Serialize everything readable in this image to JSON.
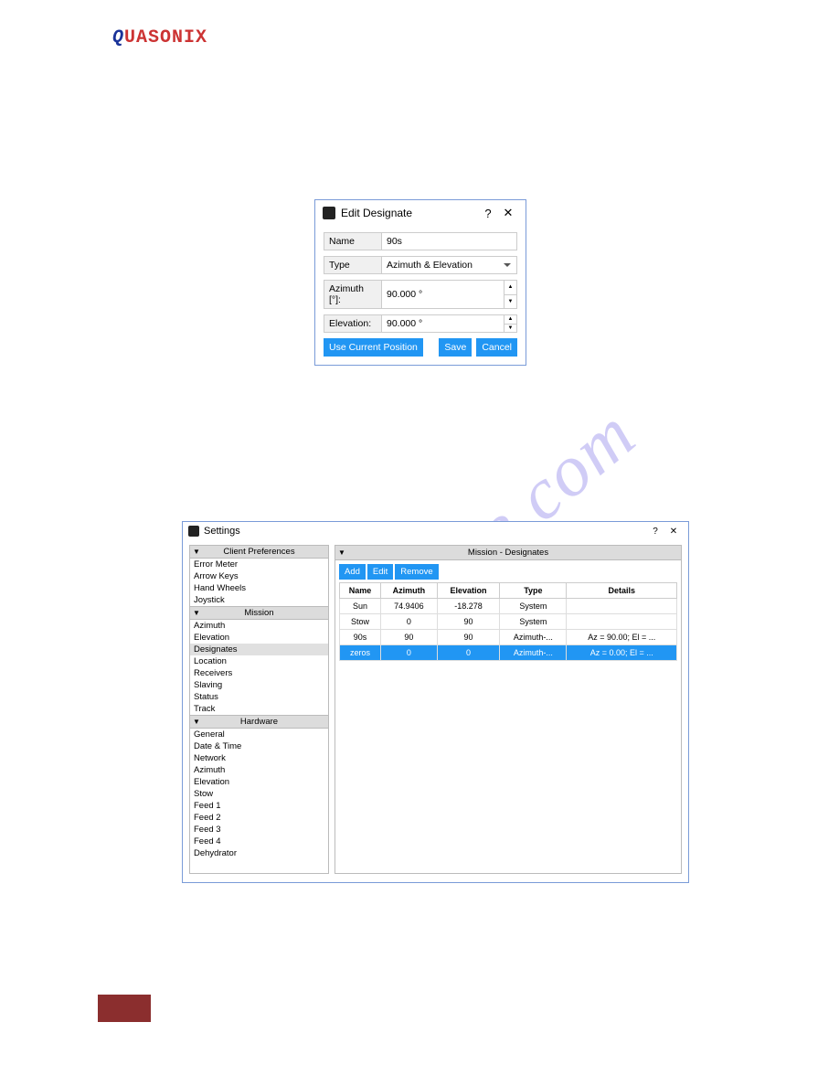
{
  "logo": {
    "q": "Q",
    "rest": "UASONIX"
  },
  "watermark": "manualshive.com",
  "editDialog": {
    "title": "Edit Designate",
    "help": "?",
    "close": "✕",
    "fields": {
      "nameLabel": "Name",
      "nameValue": "90s",
      "typeLabel": "Type",
      "typeValue": "Azimuth & Elevation",
      "azimuthLabel": "Azimuth [°]:",
      "azimuthValue": "90.000 °",
      "elevationLabel": "Elevation:",
      "elevationValue": "90.000 °"
    },
    "buttons": {
      "useCurrent": "Use Current Position",
      "save": "Save",
      "cancel": "Cancel"
    }
  },
  "settings": {
    "title": "Settings",
    "help": "?",
    "close": "✕",
    "sidebar": {
      "sections": [
        {
          "head": "Client Preferences",
          "items": [
            "Error Meter",
            "Arrow Keys",
            "Hand Wheels",
            "Joystick"
          ]
        },
        {
          "head": "Mission",
          "items": [
            "Azimuth",
            "Elevation",
            "Designates",
            "Location",
            "Receivers",
            "Slaving",
            "Status",
            "Track"
          ],
          "selected": "Designates"
        },
        {
          "head": "Hardware",
          "items": [
            "General",
            "Date & Time",
            "Network",
            "Azimuth",
            "Elevation",
            "Stow",
            "Feed 1",
            "Feed 2",
            "Feed 3",
            "Feed 4",
            "Dehydrator"
          ]
        }
      ]
    },
    "main": {
      "head": "Mission - Designates",
      "toolbar": {
        "add": "Add",
        "edit": "Edit",
        "remove": "Remove"
      },
      "columns": [
        "Name",
        "Azimuth",
        "Elevation",
        "Type",
        "Details"
      ],
      "rows": [
        {
          "name": "Sun",
          "azimuth": "74.9406",
          "elevation": "-18.278",
          "type": "System",
          "details": ""
        },
        {
          "name": "Stow",
          "azimuth": "0",
          "elevation": "90",
          "type": "System",
          "details": ""
        },
        {
          "name": "90s",
          "azimuth": "90",
          "elevation": "90",
          "type": "Azimuth-...",
          "details": "Az = 90.00; El = ..."
        },
        {
          "name": "zeros",
          "azimuth": "0",
          "elevation": "0",
          "type": "Azimuth-...",
          "details": "Az = 0.00; El = ...",
          "highlight": true
        }
      ]
    }
  }
}
